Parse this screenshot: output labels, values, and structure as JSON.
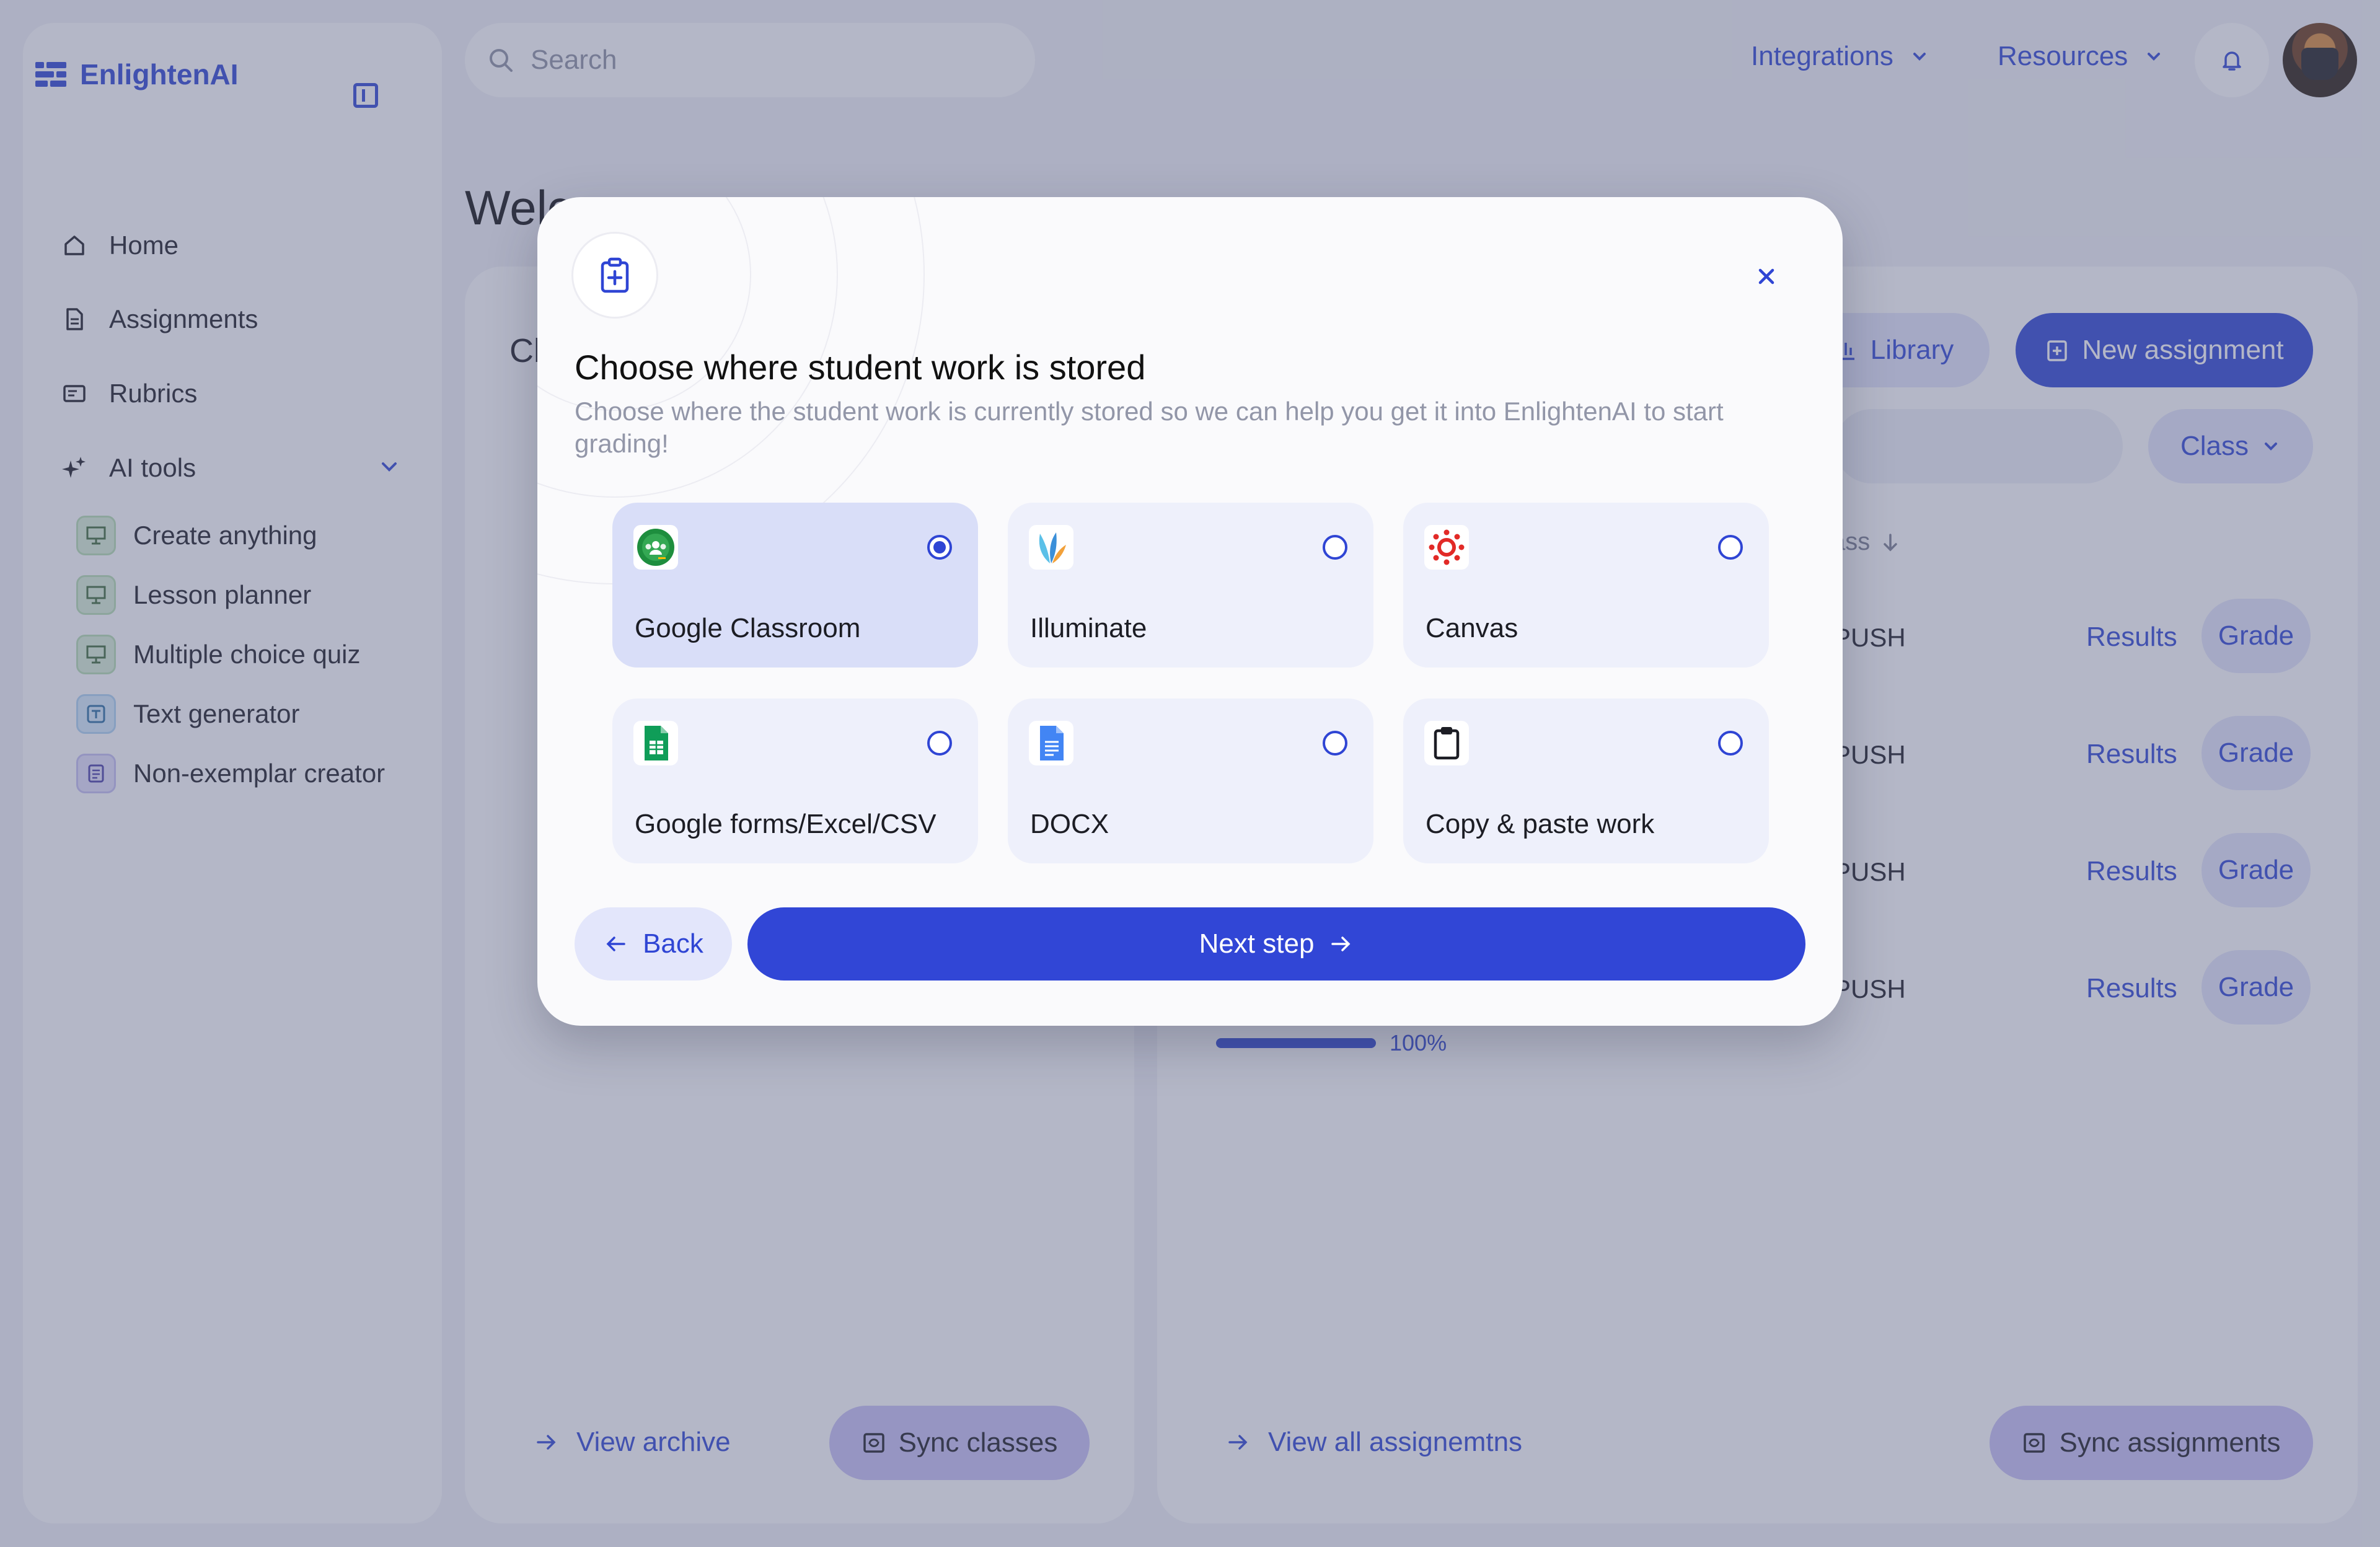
{
  "app": {
    "brand": "EnlightenAI",
    "search_placeholder": "Search",
    "top_nav": [
      "Integrations",
      "Resources"
    ]
  },
  "sidebar": {
    "items": [
      {
        "label": "Home",
        "icon": "home-icon"
      },
      {
        "label": "Assignments",
        "icon": "document-icon"
      },
      {
        "label": "Rubrics",
        "icon": "rubric-icon"
      },
      {
        "label": "AI tools",
        "icon": "sparkle-icon"
      }
    ],
    "ai_tools": [
      {
        "label": "Create anything",
        "icon": "presentation-icon",
        "color": "#d9efd6"
      },
      {
        "label": "Lesson planner",
        "icon": "presentation-icon",
        "color": "#d9efd6"
      },
      {
        "label": "Multiple choice quiz",
        "icon": "presentation-icon",
        "color": "#d9efd6"
      },
      {
        "label": "Text generator",
        "icon": "text-icon",
        "color": "#d6ebfb"
      },
      {
        "label": "Non-exemplar creator",
        "icon": "list-icon",
        "color": "#e4e1fb"
      }
    ]
  },
  "main": {
    "welcome": "Welc",
    "left_panel_title": "Cl",
    "library_label": "Library",
    "new_assignment_label": "New assignment",
    "class_filter_label": "Class",
    "column_header": "ass",
    "rows": [
      {
        "status": "PUSH",
        "results": "Results",
        "grade": "Grade"
      },
      {
        "status": "PUSH",
        "results": "Results",
        "grade": "Grade"
      },
      {
        "status": "PUSH",
        "results": "Results",
        "grade": "Grade"
      },
      {
        "status": "PUSH",
        "results": "Results",
        "grade": "Grade"
      }
    ],
    "progress_value": 1.0,
    "progress_label": "100%",
    "view_archive": "View archive",
    "sync_classes": "Sync classes",
    "view_all_assignments": "View all assignemtns",
    "sync_assignments": "Sync assignments"
  },
  "modal": {
    "title": "Choose where student work is stored",
    "subtitle": "Choose where the student work is currently stored so we can help you get it into EnlightenAI to start grading!",
    "options": [
      {
        "label": "Google Classroom",
        "icon": "google-classroom-icon",
        "selected": true
      },
      {
        "label": "Illuminate",
        "icon": "illuminate-icon",
        "selected": false
      },
      {
        "label": "Canvas",
        "icon": "canvas-icon",
        "selected": false
      },
      {
        "label": "Google forms/Excel/CSV",
        "icon": "google-sheets-icon",
        "selected": false
      },
      {
        "label": "DOCX",
        "icon": "google-docs-icon",
        "selected": false
      },
      {
        "label": "Copy & paste work",
        "icon": "clipboard-icon",
        "selected": false
      }
    ],
    "back_label": "Back",
    "next_label": "Next step"
  },
  "colors": {
    "accent": "#2f45d4",
    "overlay": "#586082",
    "selected_option": "#d9def8",
    "option_bg": "#eef0fb"
  }
}
